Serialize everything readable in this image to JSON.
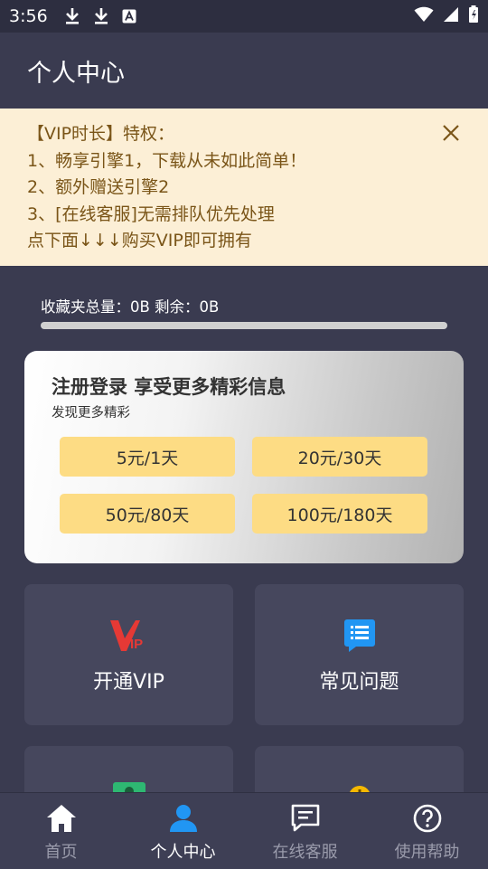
{
  "status": {
    "time": "3:56",
    "icons": [
      "download-icon",
      "download-icon",
      "font-a-icon",
      "wifi-icon",
      "signal-icon",
      "battery-icon"
    ]
  },
  "header": {
    "title": "个人中心"
  },
  "notice": {
    "lines": [
      "【VIP时长】特权：",
      "1、畅享引擎1，下载从未如此简单！",
      "2、额外赠送引擎2",
      "3、[在线客服]无需排队优先处理",
      "点下面↓↓↓购买VIP即可拥有"
    ],
    "close_icon": "close-icon"
  },
  "storage": {
    "label": "收藏夹总量：0B 剩余：0B",
    "used_fraction": 0
  },
  "promo": {
    "title": "注册登录 享受更多精彩信息",
    "subtitle": "发现更多精彩",
    "plans": [
      "5元/1天",
      "20元/30天",
      "50元/80天",
      "100元/180天"
    ]
  },
  "tiles": [
    {
      "label": "开通VIP",
      "icon": "vip-icon"
    },
    {
      "label": "常见问题",
      "icon": "faq-icon"
    },
    {
      "label": "",
      "icon": "green-icon"
    },
    {
      "label": "",
      "icon": "yellow-icon"
    }
  ],
  "nav": {
    "items": [
      {
        "label": "首页",
        "icon": "home-icon"
      },
      {
        "label": "个人中心",
        "icon": "user-icon"
      },
      {
        "label": "在线客服",
        "icon": "chat-icon"
      },
      {
        "label": "使用帮助",
        "icon": "help-icon"
      }
    ],
    "active_index": 1
  },
  "colors": {
    "background": "#3a3b50",
    "notice_bg": "#fcefd6",
    "notice_text": "#7a5518",
    "price_button": "#fddc84",
    "nav_active": "#ffffff",
    "nav_inactive": "#9a9bab",
    "accent_blue": "#2196f3",
    "vip_red": "#e53935"
  }
}
